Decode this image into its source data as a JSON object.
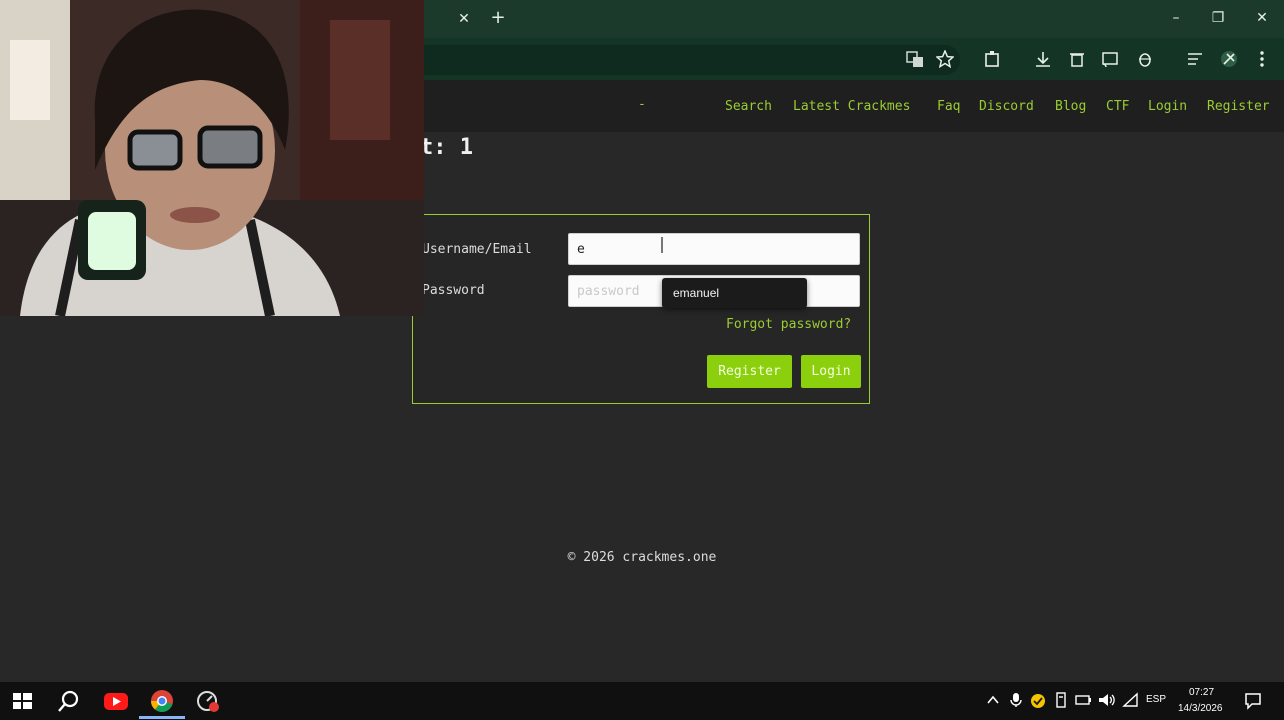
{
  "browser": {
    "tab_close_glyph": "✕",
    "new_tab_glyph": "+",
    "window_controls": {
      "minimize": "–",
      "maximize": "❐",
      "close": "✕"
    },
    "toolbar_icons": [
      "translate-icon",
      "star-icon",
      "extension-icon",
      "download-icon",
      "delete-icon",
      "cast-icon",
      "bug-icon",
      "reading-list-icon",
      "profile-icon",
      "menu-icon"
    ]
  },
  "nav": {
    "dot": "-",
    "items": [
      "Search",
      "Latest Crackmes",
      "Faq",
      "Discord",
      "Blog",
      "CTF",
      "Login",
      "Register"
    ]
  },
  "page": {
    "heading": "t: 1"
  },
  "login": {
    "username_label": "Username/Email",
    "username_value": "e",
    "password_label": "Password",
    "password_placeholder": "password",
    "forgot_link": "Forgot password?",
    "register_button": "Register",
    "login_button": "Login",
    "autocomplete_suggestion": "emanuel"
  },
  "footer": {
    "text": "© 2026 crackmes.one"
  },
  "taskbar": {
    "apps": [
      "windows-start-icon",
      "search-icon",
      "youtube-icon",
      "chrome-icon",
      "recorder-icon"
    ],
    "language": "ESP",
    "time": "07:27",
    "date": "14/3/2026"
  },
  "colors": {
    "accent": "#9acd32",
    "button": "#8ccf0d",
    "page_bg": "#282828",
    "chrome_bg": "#143526"
  }
}
